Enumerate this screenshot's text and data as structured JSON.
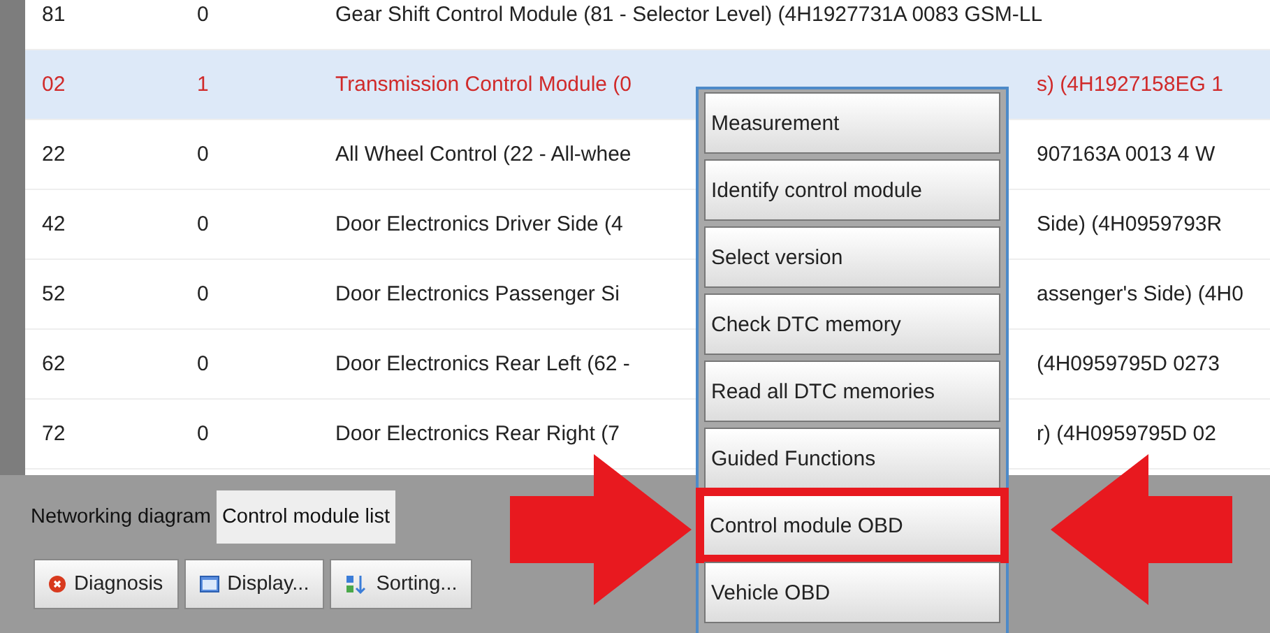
{
  "table": {
    "rows": [
      {
        "address": "81",
        "status": "0",
        "description": "Gear Shift Control Module (81 - Selector Level) (4H1927731A   0083   GSM-LL",
        "description_end": "",
        "selected": false
      },
      {
        "address": "02",
        "status": "1",
        "description": "Transmission Control Module (0",
        "description_end": "s) (4H1927158EG   1",
        "selected": true
      },
      {
        "address": "22",
        "status": "0",
        "description": "All Wheel Control (22 - All-whee",
        "description_end": "907163A   0013   4 W",
        "selected": false
      },
      {
        "address": "42",
        "status": "0",
        "description": "Door Electronics Driver Side (4",
        "description_end": "Side) (4H0959793R",
        "selected": false
      },
      {
        "address": "52",
        "status": "0",
        "description": "Door Electronics Passenger Si",
        "description_end": "assenger's Side) (4H0",
        "selected": false
      },
      {
        "address": "62",
        "status": "0",
        "description": "Door Electronics Rear Left (62 -",
        "description_end": "(4H0959795D   0273",
        "selected": false
      },
      {
        "address": "72",
        "status": "0",
        "description": "Door Electronics Rear Right (7",
        "description_end": "r) (4H0959795D   02",
        "selected": false
      }
    ]
  },
  "context_menu": {
    "items": [
      {
        "label": "Measurement",
        "highlighted": false
      },
      {
        "label": "Identify control module",
        "highlighted": false
      },
      {
        "label": "Select version",
        "highlighted": false
      },
      {
        "label": "Check DTC memory",
        "highlighted": false
      },
      {
        "label": "Read all DTC memories",
        "highlighted": false
      },
      {
        "label": "Guided Functions",
        "highlighted": false
      },
      {
        "label": "Control module OBD",
        "highlighted": true
      },
      {
        "label": "Vehicle OBD",
        "highlighted": false
      }
    ]
  },
  "view_tabs": [
    {
      "label": "Networking diagram",
      "selected": false
    },
    {
      "label": "Control module list",
      "selected": true
    }
  ],
  "buttons": [
    {
      "label": "Diagnosis",
      "kind": "diagnosis"
    },
    {
      "label": "Display...",
      "kind": "display"
    },
    {
      "label": "Sorting...",
      "kind": "sorting"
    }
  ]
}
